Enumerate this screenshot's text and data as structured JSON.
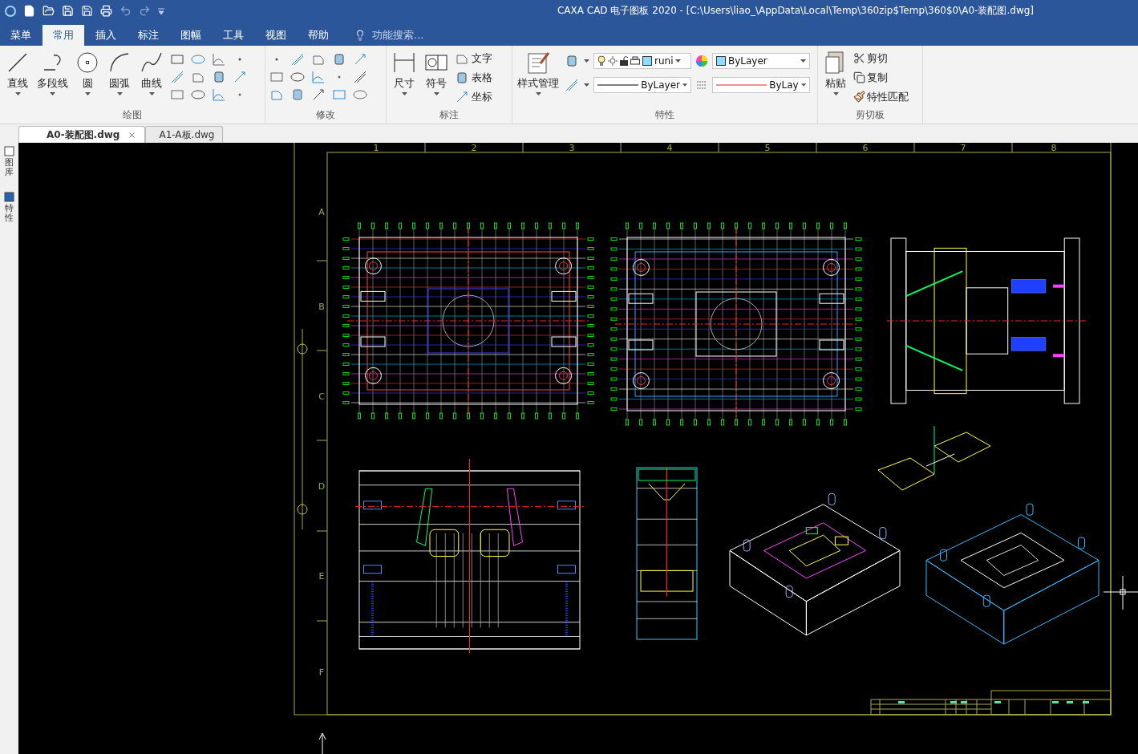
{
  "title_bar": {
    "title": "CAXA CAD 电子图板 2020 - [C:\\Users\\liao_\\AppData\\Local\\Temp\\360zip$Temp\\360$0\\A0-装配图.dwg]"
  },
  "menu_tabs": [
    {
      "label": "菜单",
      "selected": false
    },
    {
      "label": "常用",
      "selected": true
    },
    {
      "label": "插入",
      "selected": false
    },
    {
      "label": "标注",
      "selected": false
    },
    {
      "label": "图幅",
      "selected": false
    },
    {
      "label": "工具",
      "selected": false
    },
    {
      "label": "视图",
      "selected": false
    },
    {
      "label": "帮助",
      "selected": false
    }
  ],
  "search": {
    "placeholder": "功能搜索..."
  },
  "ribbon": {
    "draw": {
      "label": "绘图",
      "tools": [
        "直线",
        "多段线",
        "圆",
        "圆弧",
        "曲线"
      ]
    },
    "modify": {
      "label": "修改"
    },
    "annotate": {
      "label": "标注",
      "large": [
        "尺寸",
        "符号"
      ],
      "small": [
        "文字",
        "表格",
        "坐标"
      ]
    },
    "properties": {
      "label": "特性",
      "style_manager": "样式管理",
      "layer": "runi",
      "color_setting": "ByLayer",
      "linetype": "ByLayer",
      "lineweight": "ByLay"
    },
    "clipboard": {
      "label": "剪切板",
      "paste": "粘贴",
      "small": [
        "剪切",
        "复制",
        "特性匹配"
      ]
    }
  },
  "side_panel": [
    "图库",
    "特性"
  ],
  "doc_tabs": [
    {
      "label": "A0-装配图.dwg",
      "selected": true
    },
    {
      "label": "A1-A板.dwg",
      "selected": false
    }
  ],
  "frame": {
    "columns": [
      "1",
      "2",
      "3",
      "4",
      "5",
      "6",
      "7",
      "8"
    ],
    "rows": [
      "A",
      "B",
      "C",
      "D",
      "E",
      "F"
    ]
  }
}
